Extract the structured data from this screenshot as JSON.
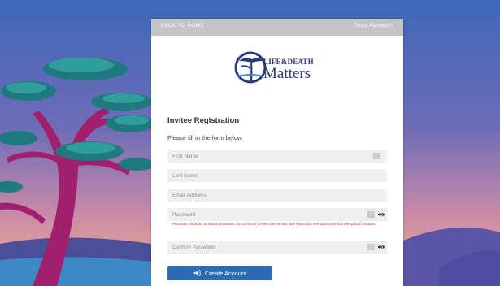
{
  "nav": {
    "back_label": "BACK TO HOME",
    "forgot_label": "Forgot Password?"
  },
  "logo": {
    "line1": "LIFE&DEATH",
    "line2": "Matters"
  },
  "form": {
    "title": "Invitee Registration",
    "subtitle": "Please fill in the form below.",
    "first_name_placeholder": "First Name",
    "last_name_placeholder": "Last Name",
    "email_placeholder": "Email Address",
    "password_placeholder": "Password",
    "password_hint": "Password should be at least 8 characters and consist of at least one number, one lowercase, one uppercase and one special character.",
    "confirm_placeholder": "Confirm Password",
    "submit_label": "Create Account"
  },
  "icons": {
    "keyboard": "keyboard-icon",
    "eye": "eye-icon",
    "signin": "sign-in-icon"
  },
  "colors": {
    "button": "#2a6bb3",
    "brand": "#2c3a78",
    "hint": "#d2232a",
    "topbar": "#c4c3c7"
  }
}
